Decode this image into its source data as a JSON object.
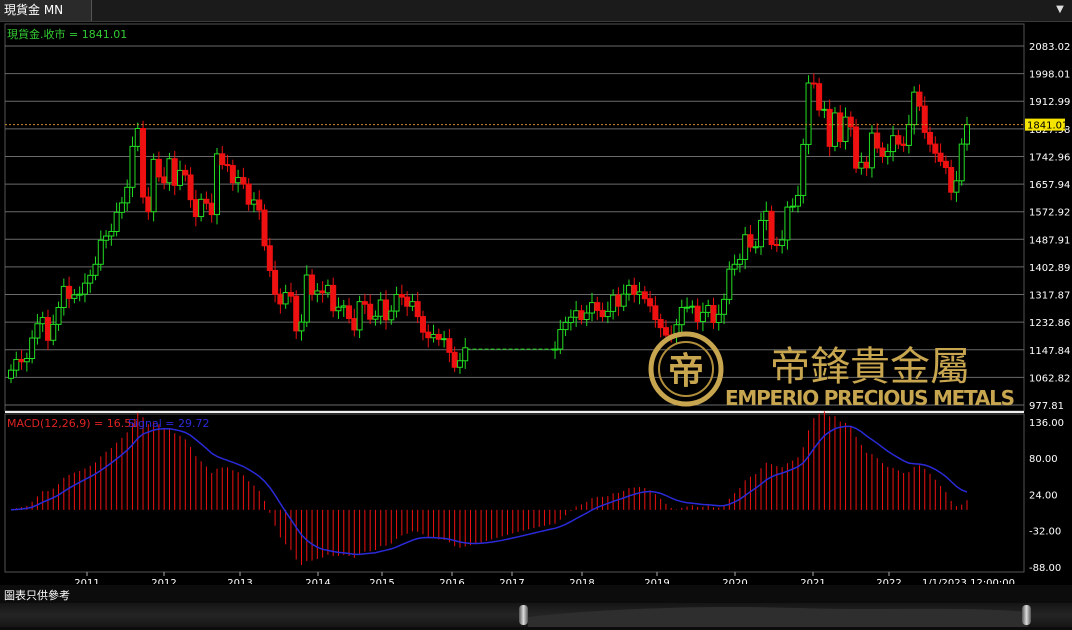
{
  "tab": {
    "title": "現貨金 MN"
  },
  "menu_icon": "chevron-down-icon",
  "price_label": "現貨金.收市 = 1841.01",
  "macd_label": "MACD(12,26,9) = 16.51",
  "signal_label": "Signal = 29.72",
  "last_price_tag": "1841.01",
  "date_label": "1/1/2023 12:00:00",
  "disclaimer": "圖表只供參考",
  "watermark": {
    "cn": "帝鋒貴金屬",
    "en": "EMPERIO PRECIOUS METALS",
    "monogram": "帝"
  },
  "colors": {
    "up": "#22dd22",
    "down": "#ee1111",
    "signal": "#2a2ad8",
    "price_line": "#d08a2a",
    "grid": "#6a6a6a",
    "label_price": "#33cc33",
    "label_macd": "#dd2222",
    "tag_bg": "#f5e400"
  },
  "chart_data": [
    {
      "type": "candlestick",
      "title": "現貨金.收市 = 1841.01",
      "y_ticks": [
        "2083.02",
        "1998.01",
        "1912.99",
        "1827.98",
        "1742.96",
        "1657.94",
        "1572.92",
        "1487.91",
        "1402.89",
        "1317.87",
        "1232.86",
        "1147.84",
        "1062.82",
        "977.81"
      ],
      "ylim": [
        977.81,
        2083.02
      ],
      "x_ticks": [
        "2011",
        "2012",
        "2013",
        "2014",
        "2015",
        "2016",
        "2017",
        "2018",
        "2019",
        "2020",
        "2021",
        "2022"
      ],
      "last_close": 1841.01,
      "closes": [
        1085,
        1118,
        1111,
        1121,
        1184,
        1228,
        1247,
        1177,
        1226,
        1278,
        1343,
        1306,
        1317,
        1319,
        1353,
        1377,
        1411,
        1485,
        1498,
        1512,
        1571,
        1600,
        1648,
        1774,
        1829,
        1618,
        1573,
        1734,
        1680,
        1662,
        1736,
        1654,
        1700,
        1686,
        1610,
        1558,
        1611,
        1599,
        1564,
        1751,
        1718,
        1715,
        1662,
        1678,
        1658,
        1596,
        1609,
        1578,
        1468,
        1392,
        1319,
        1289,
        1324,
        1313,
        1206,
        1233,
        1378,
        1319,
        1329,
        1323,
        1346,
        1268,
        1279,
        1283,
        1244,
        1209,
        1296,
        1288,
        1242,
        1251,
        1301,
        1240,
        1267,
        1318,
        1310,
        1282,
        1296,
        1250,
        1202,
        1185,
        1195,
        1180,
        1182,
        1140,
        1094,
        1114,
        1154,
        1150,
        1150,
        1150,
        1150,
        1150,
        1150,
        1150,
        1150,
        1150,
        1150,
        1150,
        1150,
        1150,
        1150,
        1150,
        1150,
        1150,
        1210,
        1232,
        1248,
        1268,
        1241,
        1261,
        1293,
        1269,
        1250,
        1266,
        1316,
        1282,
        1319,
        1346,
        1318,
        1326,
        1305,
        1283,
        1241,
        1216,
        1193,
        1190,
        1225,
        1278,
        1279,
        1282,
        1235,
        1263,
        1284,
        1232,
        1257,
        1303,
        1396,
        1411,
        1426,
        1502,
        1464,
        1465,
        1546,
        1574,
        1472,
        1469,
        1486,
        1587,
        1590,
        1623,
        1780,
        1969,
        1967,
        1886,
        1888,
        1774,
        1877,
        1789,
        1864,
        1834,
        1707,
        1725,
        1708,
        1815,
        1769,
        1743,
        1758,
        1807,
        1781,
        1777,
        1841,
        1941,
        1898,
        1817,
        1781,
        1753,
        1728,
        1709,
        1633,
        1668,
        1781,
        1841
      ],
      "macd": {
        "name": "MACD(12,26,9)",
        "last_macd": 16.51,
        "last_signal": 29.72,
        "y_ticks": [
          "136.00",
          "80.00",
          "24.00",
          "-32.00",
          "-88.00"
        ],
        "ylim": [
          -96,
          148
        ]
      }
    }
  ]
}
